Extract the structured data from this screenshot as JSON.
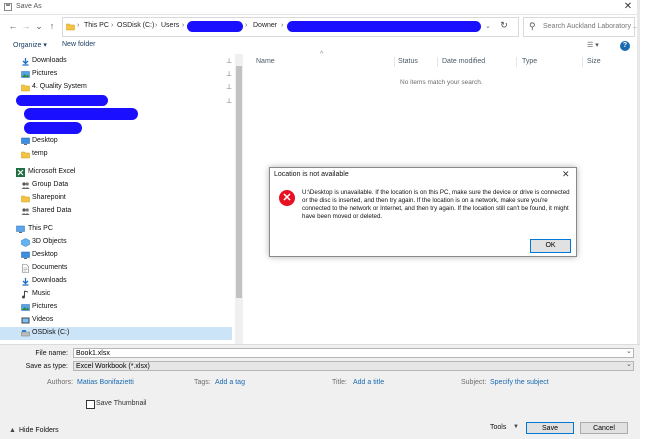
{
  "window": {
    "title": "Save As",
    "close_glyph": "✕"
  },
  "nav": {
    "back": "←",
    "forward": "→",
    "up_history": "⌄",
    "up": "↑",
    "breadcrumbs": [
      "This PC",
      "OSDisk (C:)",
      "Users",
      "Downer"
    ],
    "separator": "›",
    "refresh_glyph": "↻",
    "search_placeholder": "Search Auckland Laboratory ..."
  },
  "toolbar": {
    "organize": "Organize ▾",
    "new_folder": "New folder",
    "help": "?",
    "view": "☰ ▾"
  },
  "sidebar": {
    "quick_access": [
      {
        "label": "Downloads",
        "icon": "download-icon",
        "pinned": true
      },
      {
        "label": "Pictures",
        "icon": "pictures-icon",
        "pinned": true
      },
      {
        "label": "4. Quality System",
        "icon": "folder-icon",
        "pinned": true
      },
      {
        "label": "Desktop",
        "icon": "desktop-icon",
        "pinned": false
      },
      {
        "label": "temp",
        "icon": "folder-icon",
        "pinned": false
      }
    ],
    "excel": {
      "label": "Microsoft Excel"
    },
    "excel_items": [
      {
        "label": "Group Data",
        "icon": "group-icon"
      },
      {
        "label": "Sharepoint",
        "icon": "folder-icon"
      },
      {
        "label": "Shared Data",
        "icon": "group-icon"
      }
    ],
    "this_pc": {
      "label": "This PC"
    },
    "pc_items": [
      {
        "label": "3D Objects",
        "icon": "3d-objects-icon"
      },
      {
        "label": "Desktop",
        "icon": "desktop-icon"
      },
      {
        "label": "Documents",
        "icon": "documents-icon"
      },
      {
        "label": "Downloads",
        "icon": "download-icon"
      },
      {
        "label": "Music",
        "icon": "music-icon"
      },
      {
        "label": "Pictures",
        "icon": "pictures-icon"
      },
      {
        "label": "Videos",
        "icon": "videos-icon"
      },
      {
        "label": "OSDisk (C:)",
        "icon": "drive-icon",
        "selected": true
      }
    ],
    "pin_glyph": "📌"
  },
  "content": {
    "columns": [
      "Name",
      "Status",
      "Date modified",
      "Type",
      "Size"
    ],
    "empty_text": "No items match your search."
  },
  "dialog": {
    "title": "Location is not available",
    "close_glyph": "✕",
    "error_glyph": "✕",
    "message": "U:\\Desktop is unavailable. If the location is on this PC, make sure the device or drive is connected or the disc is inserted, and then try again. If the location is on a network, make sure you're connected to the network or Internet, and then try again. If the location still can't be found, it might have been moved or deleted.",
    "ok": "OK"
  },
  "form": {
    "file_name_label": "File name:",
    "file_name_value": "Book1.xlsx",
    "save_type_label": "Save as type:",
    "save_type_value": "Excel Workbook (*.xlsx)",
    "authors_label": "Authors:",
    "authors_value": "Matias Bonifazietti",
    "tags_label": "Tags:",
    "tags_value": "Add a tag",
    "title_label": "Title:",
    "title_value": "Add a title",
    "subject_label": "Subject:",
    "subject_value": "Specify the subject",
    "thumbnail_label": "Save Thumbnail",
    "hide_folders": "Hide Folders",
    "tools": "Tools",
    "save": "Save",
    "cancel": "Cancel",
    "dropdown_glyph": "⌄"
  },
  "colors": {
    "accent": "#0078d7",
    "error": "#e81123",
    "selection": "#cce4f7",
    "redaction": "#1a10ff"
  }
}
